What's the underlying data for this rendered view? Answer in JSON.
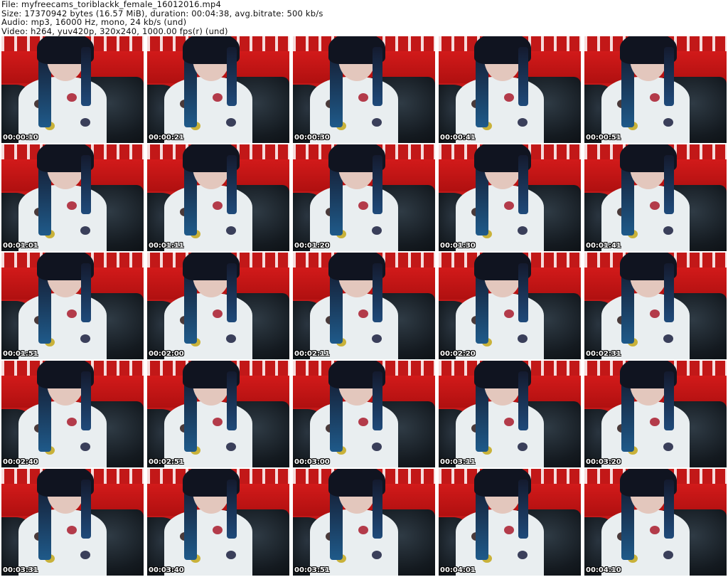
{
  "header": {
    "file_line": "File: myfreecams_toriblackk_female_16012016.mp4",
    "size_line": "Size: 17370942 bytes (16.57 MiB), duration: 00:04:38, avg.bitrate: 500 kb/s",
    "audio_line": "Audio: mp3, 16000 Hz, mono, 24 kb/s (und)",
    "video_line": "Video: h264, yuv420p, 320x240, 1000.00 fps(r) (und)"
  },
  "thumbnails": [
    {
      "timestamp": "00:00:10"
    },
    {
      "timestamp": "00:00:21"
    },
    {
      "timestamp": "00:00:30"
    },
    {
      "timestamp": "00:00:41"
    },
    {
      "timestamp": "00:00:51"
    },
    {
      "timestamp": "00:01:01"
    },
    {
      "timestamp": "00:01:11"
    },
    {
      "timestamp": "00:01:20"
    },
    {
      "timestamp": "00:01:30"
    },
    {
      "timestamp": "00:01:41"
    },
    {
      "timestamp": "00:01:51"
    },
    {
      "timestamp": "00:02:00"
    },
    {
      "timestamp": "00:02:11"
    },
    {
      "timestamp": "00:02:20"
    },
    {
      "timestamp": "00:02:31"
    },
    {
      "timestamp": "00:02:40"
    },
    {
      "timestamp": "00:02:51"
    },
    {
      "timestamp": "00:03:00"
    },
    {
      "timestamp": "00:03:11"
    },
    {
      "timestamp": "00:03:20"
    },
    {
      "timestamp": "00:03:31"
    },
    {
      "timestamp": "00:03:40"
    },
    {
      "timestamp": "00:03:51"
    },
    {
      "timestamp": "00:04:01"
    },
    {
      "timestamp": "00:04:10"
    }
  ]
}
